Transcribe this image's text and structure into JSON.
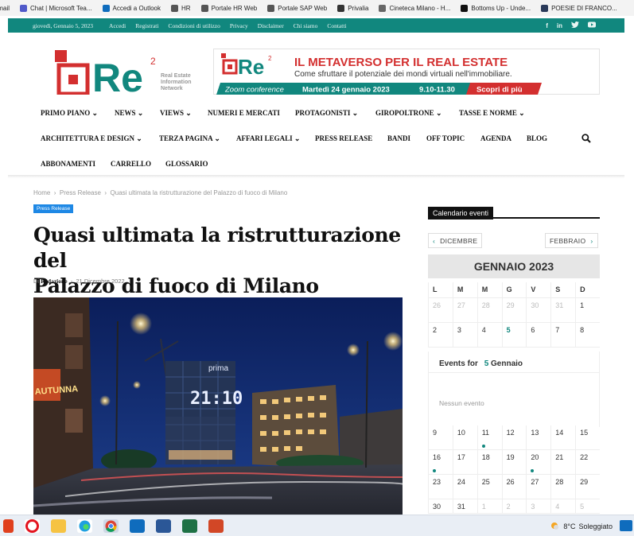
{
  "bookmarks": [
    {
      "label": "Email",
      "color": "#d44638"
    },
    {
      "label": "Chat | Microsoft Tea...",
      "color": "#5059c9"
    },
    {
      "label": "Accedi a Outlook",
      "color": "#0f6cbd"
    },
    {
      "label": "HR",
      "color": "#555"
    },
    {
      "label": "Portale HR Web",
      "color": "#555"
    },
    {
      "label": "Portale SAP Web",
      "color": "#555"
    },
    {
      "label": "Privalia",
      "color": "#333"
    },
    {
      "label": "Cineteca Milano - H...",
      "color": "#666"
    },
    {
      "label": "Bottoms Up - Unde...",
      "color": "#111"
    },
    {
      "label": "POESIE DI FRANCO...",
      "color": "#2a3a5a"
    }
  ],
  "topbar": {
    "date": "giovedì, Gennaio 5, 2023",
    "links": [
      "Accedi",
      "Registrati",
      "Condizioni di utilizzo",
      "Privacy",
      "Disclaimer",
      "Chi siamo",
      "Contatti"
    ],
    "social": [
      "f",
      "in",
      "t",
      "yt"
    ]
  },
  "logo": {
    "text": "Re",
    "sup": "2",
    "tagline": [
      "Real Estate",
      "Information",
      "Network"
    ]
  },
  "banner": {
    "headline": "IL METAVERSO PER IL REAL ESTATE",
    "subline": "Come sfruttare il potenziale dei mondi virtuali nell'immobiliare.",
    "conf": "Zoom conference",
    "date": "Martedì 24 gennaio 2023",
    "time": "9.10-11.30",
    "cta": "Scopri di più",
    "logo_text": "Re",
    "logo_sup": "2"
  },
  "nav": {
    "row1": [
      "PRIMO PIANO",
      "NEWS",
      "VIEWS",
      "NUMERI E MERCATI",
      "PROTAGONISTI",
      "GIROPOLTRONE",
      "TASSE E NORME"
    ],
    "row2": [
      "ARCHITETTURA E DESIGN",
      "TERZA PAGINA",
      "AFFARI LEGALI",
      "PRESS RELEASE",
      "BANDI",
      "OFF TOPIC",
      "AGENDA",
      "BLOG"
    ],
    "row3": [
      "ABBONAMENTI",
      "CARRELLO",
      "GLOSSARIO"
    ],
    "dropdown_marker": "⌄"
  },
  "breadcrumb": [
    "Home",
    "Press Release",
    "Quasi ultimata la ristrutturazione del Palazzo di fuoco di Milano"
  ],
  "article": {
    "category": "Press Release",
    "title_line1": "Quasi ultimata la ristrutturazione del",
    "title_line2": "Palazzo di fuoco di Milano",
    "by": "Di",
    "author": "Redazione",
    "date": "21 Dicembre 2022",
    "photo_sign": "prima",
    "photo_clock": "21:10",
    "photo_shop": "AUTUNNA"
  },
  "calendar": {
    "widget_title": "Calendario eventi",
    "prev": "DICEMBRE",
    "next": "FEBBRAIO",
    "month": "GENNAIO 2023",
    "weekdays": [
      "L",
      "M",
      "M",
      "G",
      "V",
      "S",
      "D"
    ],
    "week1": [
      "26",
      "27",
      "28",
      "29",
      "30",
      "31",
      "1"
    ],
    "week2": [
      "2",
      "3",
      "4",
      "5",
      "6",
      "7",
      "8"
    ],
    "events_label": "Events for",
    "events_day": "5",
    "events_month": "Gennaio",
    "no_events": "Nessun evento",
    "week3": [
      "9",
      "10",
      "11",
      "12",
      "13",
      "14",
      "15"
    ],
    "week4": [
      "16",
      "17",
      "18",
      "19",
      "20",
      "21",
      "22"
    ],
    "week5": [
      "23",
      "24",
      "25",
      "26",
      "27",
      "28",
      "29"
    ],
    "week6": [
      "30",
      "31",
      "1",
      "2",
      "3",
      "4",
      "5"
    ],
    "event_days": [
      "11",
      "16",
      "20"
    ],
    "today": "5"
  },
  "taskbar": {
    "temp": "8°C",
    "weather": "Soleggiato"
  }
}
